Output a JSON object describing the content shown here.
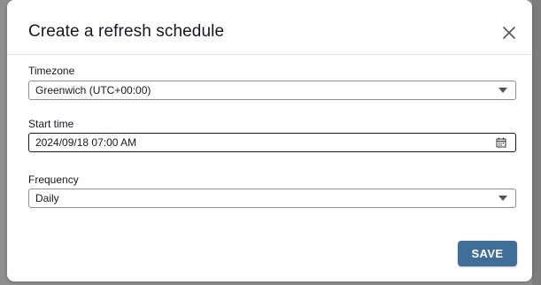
{
  "dialog": {
    "title": "Create a refresh schedule",
    "close_icon": "close-icon"
  },
  "fields": {
    "timezone": {
      "label": "Timezone",
      "value": "Greenwich (UTC+00:00)",
      "icon": "chevron-down-icon"
    },
    "start_time": {
      "label": "Start time",
      "value": "2024/09/18 07:00 AM",
      "icon": "calendar-icon"
    },
    "frequency": {
      "label": "Frequency",
      "value": "Daily",
      "icon": "chevron-down-icon"
    }
  },
  "actions": {
    "save_label": "SAVE"
  },
  "colors": {
    "primary_button": "#3f6f99",
    "overlay": "#8f8f8f",
    "text": "#16191f"
  }
}
